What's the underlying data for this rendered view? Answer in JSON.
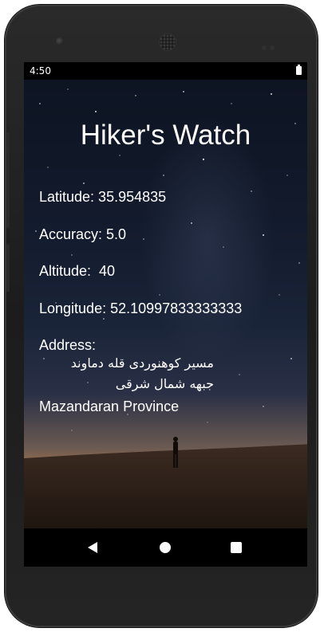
{
  "status_bar": {
    "time": "4:50",
    "battery_icon": "battery-full-icon"
  },
  "app": {
    "title": "Hiker's Watch",
    "latitude": "Latitude: 35.954835",
    "accuracy": "Accuracy: 5.0",
    "altitude": "Altitude:  40",
    "longitude": "Longitude: 52.10997833333333",
    "address_label": "Address:",
    "address_line1": "مسیر کوهنوردی قله دماوند",
    "address_line2": "جبهه شمال شرقی",
    "address_line3": "Mazandaran Province",
    "background": "night-sky-hiker-image"
  },
  "nav_bar": {
    "back_icon": "back-triangle-icon",
    "home_icon": "home-circle-icon",
    "recents_icon": "recents-square-icon"
  }
}
